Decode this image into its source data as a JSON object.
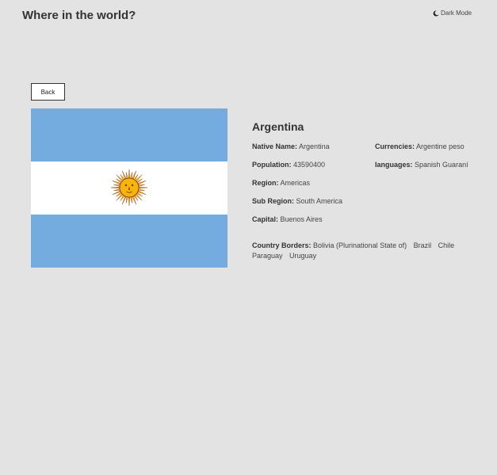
{
  "header": {
    "title": "Where in the world?",
    "dark_mode_label": "Dark Mode"
  },
  "back_label": "Back",
  "country": {
    "name": "Argentina",
    "native_name_label": "Native Name:",
    "native_name": "Argentina",
    "population_label": "Population:",
    "population": "43590400",
    "region_label": "Region:",
    "region": "Americas",
    "sub_region_label": "Sub Region:",
    "sub_region": "South America",
    "capital_label": "Capital:",
    "capital": "Buenos Aires",
    "currencies_label": "Currencies:",
    "currencies": "Argentine peso",
    "languages_label": "languages:",
    "languages": "Spanish Guaraní",
    "borders_label": "Country Borders:",
    "borders": [
      "Bolivia (Plurinational State of)",
      "Brazil",
      "Chile",
      "Paraguay",
      "Uruguay"
    ]
  },
  "colors": {
    "background": "#e3e3e3",
    "flag_blue": "#74acdf",
    "flag_white": "#ffffff",
    "sun": "#f6b40e",
    "sun_outline": "#85340a"
  }
}
